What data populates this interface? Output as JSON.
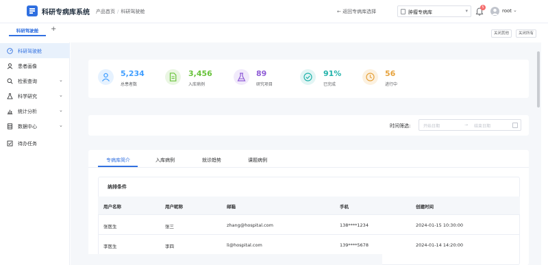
{
  "header": {
    "app_title": "科研专病库系统",
    "breadcrumb": [
      "产品首页",
      "科研驾驶舱"
    ],
    "breadcrumb_sep": "/",
    "return_link": "返回专病库选择",
    "return_arrow": "←",
    "database_select": "肿瘤专病库",
    "select_arrow": "▾",
    "notification_count": "5",
    "user_name": "root",
    "user_arrow": "⌄"
  },
  "tabs_bar": {
    "active_tag": "科研驾驶舱",
    "add_tab": "+",
    "close_others": "关闭其他",
    "close_all": "关闭所有"
  },
  "sidebar": {
    "items": [
      {
        "label": "科研驾驶舱",
        "icon": "dashboard-icon",
        "active": true,
        "has_arrow": false
      },
      {
        "label": "患者画像",
        "icon": "user-icon",
        "active": false,
        "has_arrow": false
      },
      {
        "label": "检索查询",
        "icon": "search-icon",
        "active": false,
        "has_arrow": true
      },
      {
        "label": "科学研究",
        "icon": "flask-icon",
        "active": false,
        "has_arrow": true
      },
      {
        "label": "统计分析",
        "icon": "bar-chart-icon",
        "active": false,
        "has_arrow": true
      },
      {
        "label": "数据中心",
        "icon": "database-icon",
        "active": false,
        "has_arrow": true
      },
      {
        "label": "待办任务",
        "icon": "checkbox-icon",
        "active": false,
        "has_arrow": false
      }
    ],
    "arrow": "⌄"
  },
  "stats": [
    {
      "value": "5,234",
      "label": "总患者数",
      "color": "#409eff",
      "bg": "#e6f2ff",
      "icon": "user-icon"
    },
    {
      "value": "3,456",
      "label": "入库病例",
      "color": "#67c23a",
      "bg": "#eaf6e3",
      "icon": "document-icon"
    },
    {
      "value": "89",
      "label": "研究项目",
      "color": "#8e5bd6",
      "bg": "#f1eafb",
      "icon": "flask-icon"
    },
    {
      "value": "91%",
      "label": "已完成",
      "color": "#20b2aa",
      "bg": "#e2f5f4",
      "icon": "check-circle-icon"
    },
    {
      "value": "56",
      "label": "进行中",
      "color": "#e6a23c",
      "bg": "#fcf1e0",
      "icon": "clock-icon"
    }
  ],
  "filter": {
    "label": "时间筛选:",
    "start_placeholder": "开始日期",
    "separator": "→",
    "end_placeholder": "结束日期"
  },
  "content_tabs": [
    {
      "label": "专病库简介",
      "active": true
    },
    {
      "label": "入库病例",
      "active": false
    },
    {
      "label": "就诊趋势",
      "active": false
    },
    {
      "label": "课题病例",
      "active": false
    }
  ],
  "section": {
    "title": "纳排条件",
    "columns": [
      "用户名称",
      "用户昵称",
      "邮箱",
      "手机",
      "创建时间"
    ],
    "rows": [
      [
        "张医生",
        "张三",
        "zhang@hospital.com",
        "138****1234",
        "2024-01-15 10:30:00"
      ],
      [
        "李医生",
        "李四",
        "li@hospital.com",
        "139****5678",
        "2024-01-14 14:20:00"
      ]
    ]
  },
  "colors": {
    "accent": "#2f6fe0",
    "sidebar_active_bg": "#e8f1fc",
    "page_bg": "#f5f7fa"
  }
}
